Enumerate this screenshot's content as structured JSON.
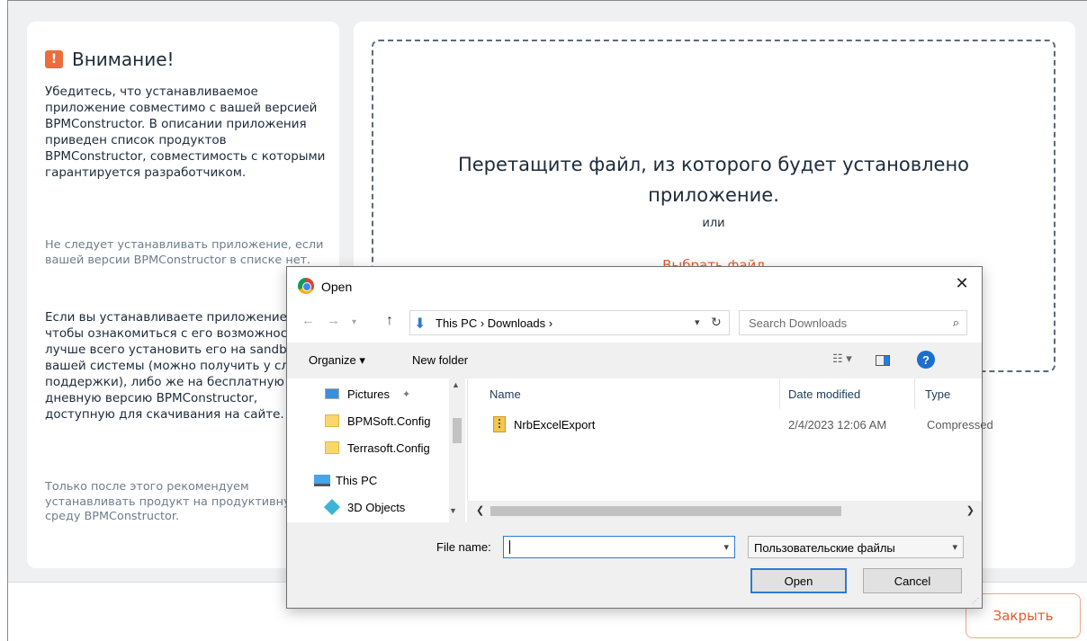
{
  "warning": {
    "title": "Внимание!",
    "icon_glyph": "!",
    "paragraph1": "Убедитесь, что устанавливаемое приложение совместимо с вашей версией BPMConstructor. В описании приложения приведен список продуктов BPMConstructor, совместимость с которыми гарантируется разработчиком.",
    "paragraph2": "Не следует устанавливать приложение, если вашей версии BPMConstructor в списке нет.",
    "paragraph3": "Если вы устанавливаете приложение, чтобы ознакомиться с его возможностями, лучше всего установить его на sandbox вашей системы (можно получить у службы поддержки), либо же на бесплатную 14-дневную версию BPMConstructor, доступную для скачивания на сайте.",
    "paragraph4": "Только после этого рекомендуем устанавливать продукт на продуктивную среду BPMConstructor."
  },
  "dropzone": {
    "title": "Перетащите файл, из которого будет установлено приложение.",
    "or": "или",
    "choose_file": "Выбрать файл"
  },
  "close_button": "Закрыть",
  "dialog": {
    "title": "Open",
    "close_glyph": "✕",
    "address_path": "This PC  ›  Downloads  ›",
    "search_placeholder": "Search Downloads",
    "organize": "Organize ▾",
    "new_folder": "New folder",
    "nav_items": [
      "Pictures",
      "BPMSoft.Config",
      "Terrasoft.Config",
      "This PC",
      "3D Objects"
    ],
    "columns": {
      "name": "Name",
      "date": "Date modified",
      "type": "Type"
    },
    "files": [
      {
        "name": "NrbExcelExport",
        "date": "2/4/2023 12:06 AM",
        "type": "Compressed"
      }
    ],
    "file_name_label": "File name:",
    "file_name_value": "",
    "filter": "Пользовательские файлы",
    "open_button": "Open",
    "cancel_button": "Cancel"
  },
  "colors": {
    "accent": "#e25d2e",
    "warning_icon": "#ec6c3b",
    "link_blue": "#2d7bd5"
  }
}
